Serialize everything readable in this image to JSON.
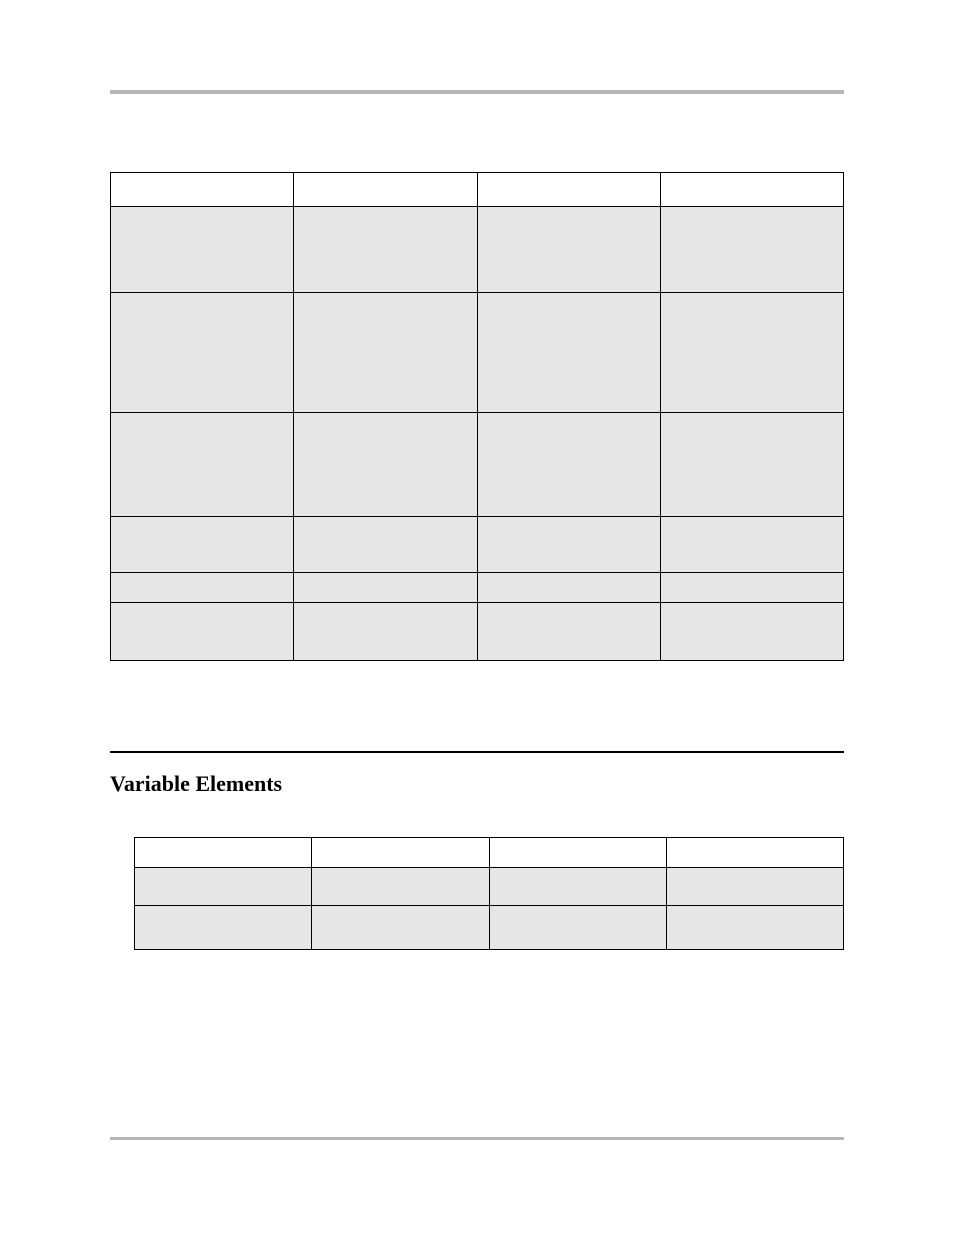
{
  "section": {
    "title": "Variable Elements"
  },
  "table1": {
    "headers": [
      "",
      "",
      "",
      ""
    ],
    "rows": [
      [
        "",
        "",
        "",
        ""
      ],
      [
        "",
        "",
        "",
        ""
      ],
      [
        "",
        "",
        "",
        ""
      ],
      [
        "",
        "",
        "",
        ""
      ],
      [
        "",
        "",
        "",
        ""
      ],
      [
        "",
        "",
        "",
        ""
      ]
    ]
  },
  "table2": {
    "headers": [
      "",
      "",
      "",
      ""
    ],
    "rows": [
      [
        "",
        "",
        "",
        ""
      ],
      [
        "",
        "",
        "",
        ""
      ]
    ]
  }
}
